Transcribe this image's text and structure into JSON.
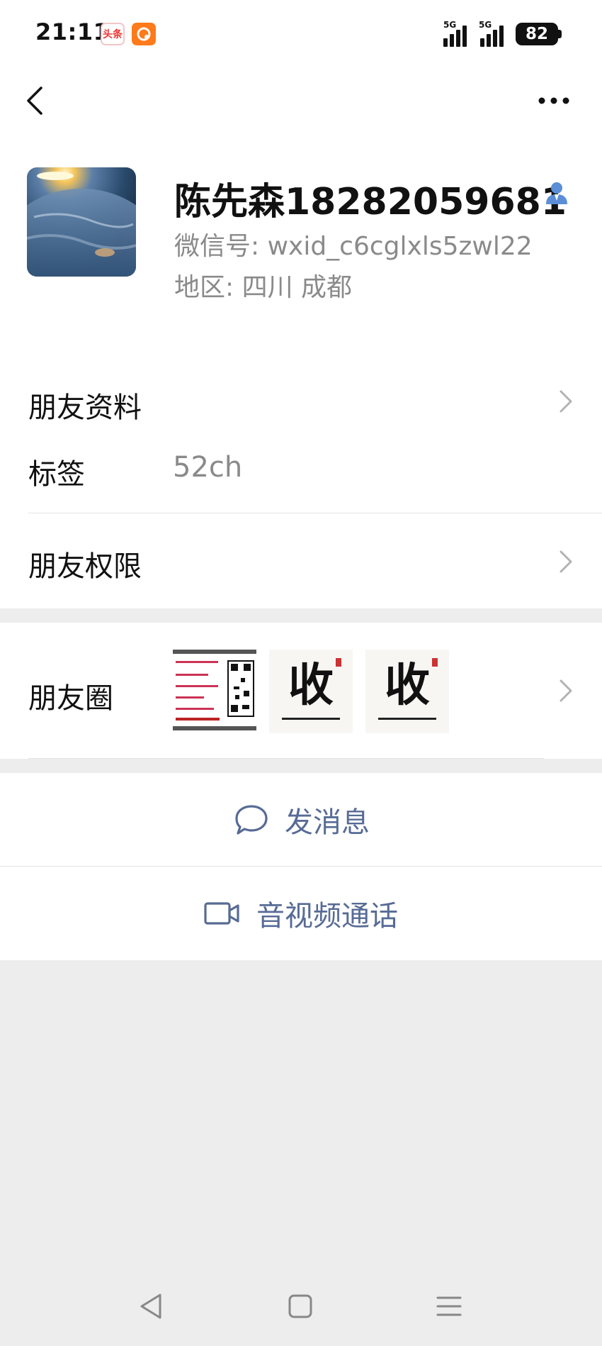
{
  "status_bar": {
    "time": "21:11",
    "apps": [
      {
        "name": "toutiao-app-icon",
        "text": "头条"
      },
      {
        "name": "orange-app-icon",
        "text": ""
      }
    ],
    "signal_1_label": "5G",
    "signal_2_label": "5G",
    "battery": "82"
  },
  "header": {
    "back_icon": "chevron-left-icon",
    "more_icon": "more-horizontal-icon"
  },
  "profile": {
    "name": "陈先森18282059681",
    "wechat_id": "微信号: wxid_c6cglxls5zwl22",
    "region": "地区: 四川  成都",
    "contact_icon": "person-icon"
  },
  "rows": {
    "friend_info": "朋友资料",
    "tags_label": "标签",
    "tags_value": "52ch",
    "permissions": "朋友权限",
    "moments": "朋友圈"
  },
  "moments_thumbs": [
    {
      "name": "moments-thumb-qr",
      "char": ""
    },
    {
      "name": "moments-thumb-calligraphy-1",
      "char": "收"
    },
    {
      "name": "moments-thumb-calligraphy-2",
      "char": "收"
    }
  ],
  "actions": {
    "send_message": "发消息",
    "video_call": "音视频通话"
  },
  "nav": {
    "back": "triangle-back-icon",
    "home": "square-home-icon",
    "menu": "menu-lines-icon"
  },
  "colors": {
    "link_blue": "#576b95",
    "contact_icon_blue": "#5b8ed6",
    "background": "#ededed"
  }
}
